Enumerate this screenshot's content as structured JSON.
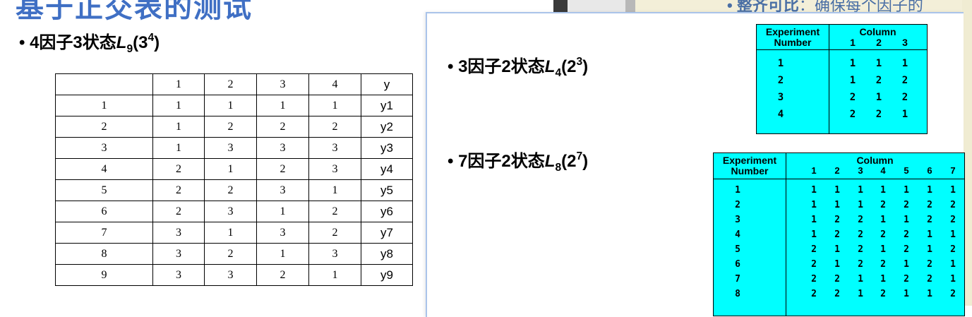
{
  "slide_title": "基于正交表的测试",
  "right_slide_bullet": {
    "bold": "• 整齐可比",
    "rest": "：确保每个因子的"
  },
  "left_bullet": {
    "prefix": "• 4因子3状态",
    "L": "L",
    "sub": "9",
    "base": "(3",
    "sup": "4",
    "close": ")"
  },
  "table_L9": {
    "header": [
      "",
      "1",
      "2",
      "3",
      "4",
      "y"
    ],
    "rows": [
      [
        "1",
        "1",
        "1",
        "1",
        "1",
        "y1"
      ],
      [
        "2",
        "1",
        "2",
        "2",
        "2",
        "y2"
      ],
      [
        "3",
        "1",
        "3",
        "3",
        "3",
        "y3"
      ],
      [
        "4",
        "2",
        "1",
        "2",
        "3",
        "y4"
      ],
      [
        "5",
        "2",
        "2",
        "3",
        "1",
        "y5"
      ],
      [
        "6",
        "2",
        "3",
        "1",
        "2",
        "y6"
      ],
      [
        "7",
        "3",
        "1",
        "3",
        "2",
        "y7"
      ],
      [
        "8",
        "3",
        "2",
        "1",
        "3",
        "y8"
      ],
      [
        "9",
        "3",
        "3",
        "2",
        "1",
        "y9"
      ]
    ]
  },
  "bullet_L4": {
    "prefix": "• 3因子2状态",
    "L": "L",
    "sub": "4",
    "base": "(2",
    "sup": "3",
    "close": ")"
  },
  "bullet_L8": {
    "prefix": "• 7因子2状态",
    "L": "L",
    "sub": "8",
    "base": "(2",
    "sup": "7",
    "close": ")"
  },
  "table_L4": {
    "col_header_left": "Experiment\nNumber",
    "col_header_right": "Column",
    "columns": [
      "1",
      "2",
      "3"
    ],
    "rows": [
      [
        "1",
        "1",
        "1",
        "1"
      ],
      [
        "2",
        "1",
        "2",
        "2"
      ],
      [
        "3",
        "2",
        "1",
        "2"
      ],
      [
        "4",
        "2",
        "2",
        "1"
      ]
    ]
  },
  "table_L8": {
    "col_header_left": "Experiment\nNumber",
    "col_header_right": "Column",
    "columns": [
      "1",
      "2",
      "3",
      "4",
      "5",
      "6",
      "7"
    ],
    "rows": [
      [
        "1",
        "1",
        "1",
        "1",
        "1",
        "1",
        "1",
        "1"
      ],
      [
        "2",
        "1",
        "1",
        "1",
        "2",
        "2",
        "2",
        "2"
      ],
      [
        "3",
        "1",
        "2",
        "2",
        "1",
        "1",
        "2",
        "2"
      ],
      [
        "4",
        "1",
        "2",
        "2",
        "2",
        "2",
        "1",
        "1"
      ],
      [
        "5",
        "2",
        "1",
        "2",
        "1",
        "2",
        "1",
        "2"
      ],
      [
        "6",
        "2",
        "1",
        "2",
        "2",
        "1",
        "2",
        "1"
      ],
      [
        "7",
        "2",
        "2",
        "1",
        "1",
        "2",
        "2",
        "1"
      ],
      [
        "8",
        "2",
        "2",
        "1",
        "2",
        "1",
        "1",
        "2"
      ]
    ]
  },
  "colors": {
    "title_blue": "#3f6fc4",
    "table_cyan": "#00ffff",
    "popup_border": "#aac4ea"
  }
}
